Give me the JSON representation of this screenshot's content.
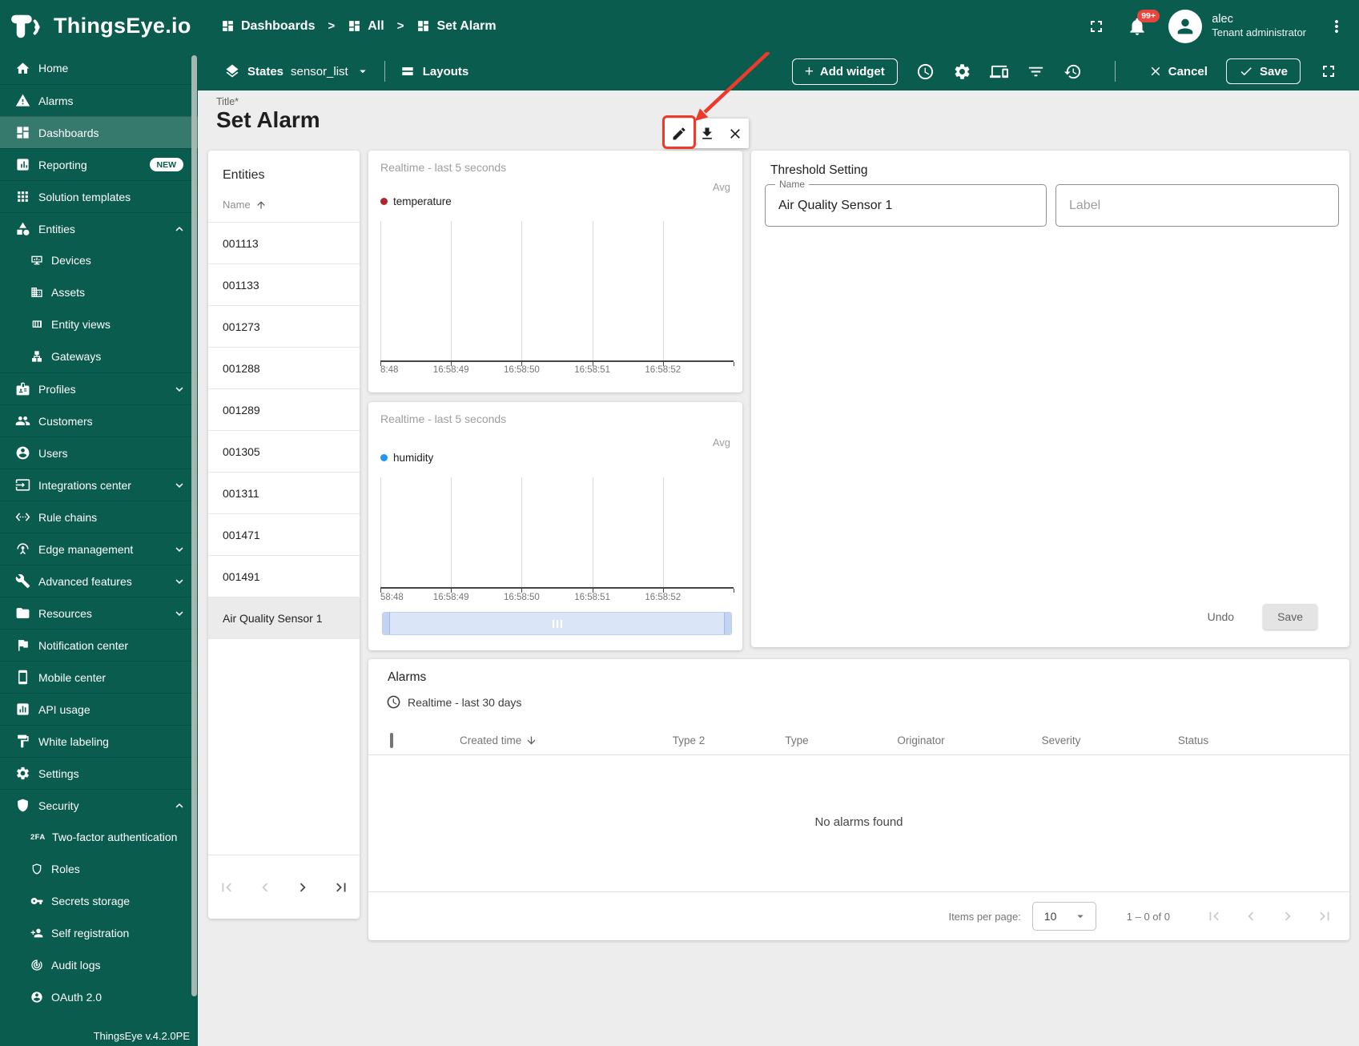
{
  "colors": {
    "teal": "#0a5c4e",
    "sidebar_active": "#3e8074",
    "badge_red": "#e8453c",
    "annotation_red": "#ee3a2b",
    "selected_row": "#ebebeb",
    "temperature_series": "#b2242e",
    "humidity_series": "#2196f3"
  },
  "app_bar": {
    "logo_text": "ThingsEye.io",
    "separator": ">",
    "breadcrumbs": [
      {
        "label": "Dashboards",
        "icon": "dashboards"
      },
      {
        "label": "All",
        "icon": "dashboards"
      },
      {
        "label": "Set Alarm",
        "icon": "dashboards"
      }
    ],
    "notification_count": "99+",
    "user_name": "alec",
    "user_role": "Tenant administrator"
  },
  "toolbar": {
    "states_label": "States",
    "states_value": "sensor_list",
    "layouts_label": "Layouts",
    "add_widget_plus": "+",
    "add_widget_label": "Add widget",
    "cancel_label": "Cancel",
    "save_label": "Save"
  },
  "page": {
    "title_hint": "Title*",
    "title": "Set Alarm"
  },
  "sidebar": {
    "items": [
      {
        "label": "Home",
        "icon": "home"
      },
      {
        "label": "Alarms",
        "icon": "warning"
      },
      {
        "label": "Dashboards",
        "icon": "dashboards",
        "active": true
      },
      {
        "label": "Reporting",
        "icon": "reporting",
        "badge": "NEW"
      },
      {
        "label": "Solution templates",
        "icon": "apps"
      },
      {
        "label": "Entities",
        "icon": "entities",
        "chevron": "up"
      },
      {
        "label": "Devices",
        "icon": "devices",
        "child": true
      },
      {
        "label": "Assets",
        "icon": "assets",
        "child": true
      },
      {
        "label": "Entity views",
        "icon": "entity-views",
        "child": true
      },
      {
        "label": "Gateways",
        "icon": "gateways",
        "child": true
      },
      {
        "label": "Profiles",
        "icon": "profiles",
        "chevron": "down"
      },
      {
        "label": "Customers",
        "icon": "customers"
      },
      {
        "label": "Users",
        "icon": "users"
      },
      {
        "label": "Integrations center",
        "icon": "integrations",
        "chevron": "down"
      },
      {
        "label": "Rule chains",
        "icon": "rule-chains"
      },
      {
        "label": "Edge management",
        "icon": "edge",
        "chevron": "down"
      },
      {
        "label": "Advanced features",
        "icon": "advanced",
        "chevron": "down"
      },
      {
        "label": "Resources",
        "icon": "resources",
        "chevron": "down"
      },
      {
        "label": "Notification center",
        "icon": "notification"
      },
      {
        "label": "Mobile center",
        "icon": "mobile"
      },
      {
        "label": "API usage",
        "icon": "api-usage"
      },
      {
        "label": "White labeling",
        "icon": "white-labeling"
      },
      {
        "label": "Settings",
        "icon": "settings"
      },
      {
        "label": "Security",
        "icon": "security",
        "chevron": "up"
      },
      {
        "label": "Two-factor authentication",
        "icon": "twofa",
        "child": true
      },
      {
        "label": "Roles",
        "icon": "roles",
        "child": true
      },
      {
        "label": "Secrets storage",
        "icon": "key",
        "child": true
      },
      {
        "label": "Self registration",
        "icon": "person-add",
        "child": true
      },
      {
        "label": "Audit logs",
        "icon": "audit",
        "child": true
      },
      {
        "label": "OAuth 2.0",
        "icon": "oauth",
        "child": true
      }
    ],
    "footer": "ThingsEye v.4.2.0PE"
  },
  "entities_panel": {
    "title": "Entities",
    "name_column": "Name",
    "rows": [
      "001113",
      "001133",
      "001273",
      "001288",
      "001289",
      "001305",
      "001311",
      "001471",
      "001491",
      "Air Quality Sensor 1"
    ],
    "selected": "Air Quality Sensor 1",
    "pagination": [
      {
        "icon": "first-page",
        "enabled": false
      },
      {
        "icon": "chevron-left",
        "enabled": false
      },
      {
        "icon": "chevron-right",
        "enabled": true
      },
      {
        "icon": "last-page",
        "enabled": true
      }
    ]
  },
  "widget_toolbar": {
    "buttons": [
      {
        "icon": "edit"
      },
      {
        "icon": "download"
      },
      {
        "icon": "close"
      }
    ],
    "highlighted": "edit"
  },
  "chart_data": [
    {
      "type": "line",
      "title": "Realtime - last 5 seconds",
      "aggregation": "Avg",
      "legend_position": "top-left",
      "series": [
        {
          "name": "temperature",
          "color": "#b2242e",
          "values": []
        }
      ],
      "x_ticks": [
        "8:48",
        "16:58:49",
        "16:58:50",
        "16:58:51",
        "16:58:52"
      ],
      "grid": "vertical",
      "has_range_selector": false
    },
    {
      "type": "line",
      "title": "Realtime - last 5 seconds",
      "aggregation": "Avg",
      "legend_position": "top-left",
      "series": [
        {
          "name": "humidity",
          "color": "#2196f3",
          "values": []
        }
      ],
      "x_ticks": [
        "58:48",
        "16:58:49",
        "16:58:50",
        "16:58:51",
        "16:58:52"
      ],
      "grid": "vertical",
      "has_range_selector": true
    }
  ],
  "threshold": {
    "title": "Threshold Setting",
    "name_label": "Name",
    "name_value": "Air Quality Sensor 1",
    "label_placeholder": "Label",
    "undo_label": "Undo",
    "save_label": "Save"
  },
  "alarms": {
    "title": "Alarms",
    "timewindow": "Realtime - last 30 days",
    "columns": [
      "Created time",
      "Type 2",
      "Type",
      "Originator",
      "Severity",
      "Status"
    ],
    "sort_column": "Created time",
    "sort_direction": "desc",
    "empty_text": "No alarms found",
    "items_per_page_label": "Items per page:",
    "items_per_page_value": "10",
    "range_label": "1 – 0 of 0",
    "pagination": [
      {
        "icon": "first-page",
        "enabled": false
      },
      {
        "icon": "chevron-left",
        "enabled": false
      },
      {
        "icon": "chevron-right",
        "enabled": false
      },
      {
        "icon": "last-page",
        "enabled": false
      }
    ]
  }
}
